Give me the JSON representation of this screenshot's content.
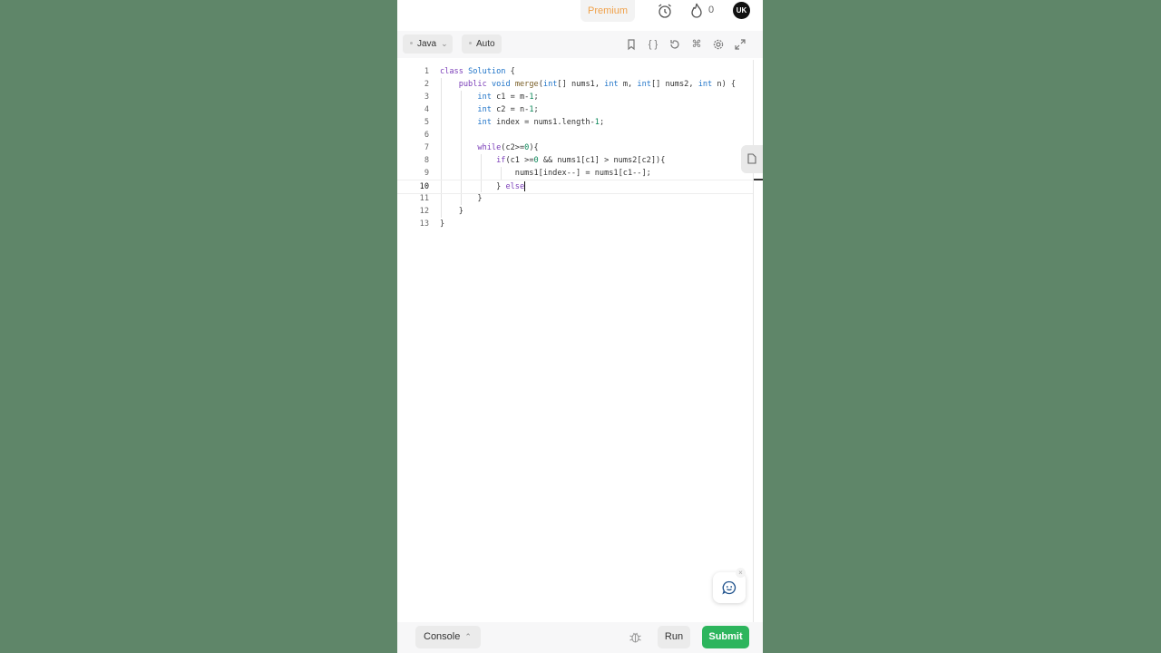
{
  "header": {
    "premium_label": "Premium",
    "streak_count": "0",
    "avatar_initials": "UK"
  },
  "toolbar": {
    "language": "Java",
    "mode": "Auto"
  },
  "editor": {
    "active_line": 10,
    "line_numbers": [
      "1",
      "2",
      "3",
      "4",
      "5",
      "6",
      "7",
      "8",
      "9",
      "10",
      "11",
      "12",
      "13"
    ]
  },
  "bottom": {
    "console_label": "Console",
    "run_label": "Run",
    "submit_label": "Submit"
  },
  "colors": {
    "background": "#5f8669",
    "accent_premium": "#f0a14a",
    "submit_green": "#2db55d"
  }
}
